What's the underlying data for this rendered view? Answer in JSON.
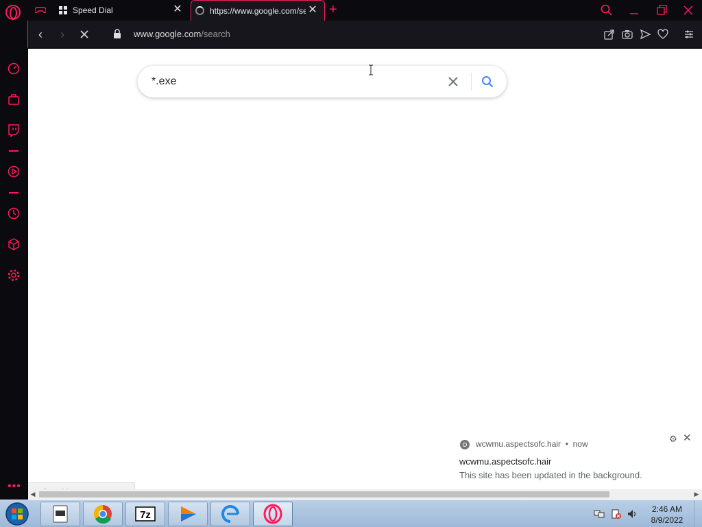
{
  "tabs": [
    {
      "label": "Speed Dial"
    },
    {
      "label": "https://www.google.com/search"
    }
  ],
  "address_bar": {
    "url_host": "www.google.com",
    "url_path": "/search"
  },
  "search": {
    "query": "*.exe"
  },
  "status_bar": {
    "text": "ng for c.bing.com..."
  },
  "notification": {
    "origin": "wcwmu.aspectsofc.hair",
    "time": "now",
    "title": "wcwmu.aspectsofc.hair",
    "body": "This site has been updated in the background."
  },
  "taskbar": {
    "time": "2:46 AM",
    "date": "8/9/2022"
  },
  "colors": {
    "accent": "#ff1b5a",
    "chrome_bg": "#0b0b0f",
    "search_blue": "#4285f4"
  },
  "icons": [
    "opera-logo-icon",
    "gamepad-icon",
    "speed-dial-grid-icon",
    "loading-spinner-icon",
    "close-icon",
    "plus-icon",
    "search-icon",
    "minimize-icon",
    "restore-icon",
    "back-icon",
    "forward-icon",
    "stop-icon",
    "lock-icon",
    "share-icon",
    "camera-icon",
    "send-icon",
    "heart-icon",
    "menu-icon",
    "speedometer-icon",
    "bag-icon",
    "twitch-icon",
    "player-icon",
    "history-icon",
    "cube-icon",
    "gear-icon",
    "more-icon"
  ]
}
